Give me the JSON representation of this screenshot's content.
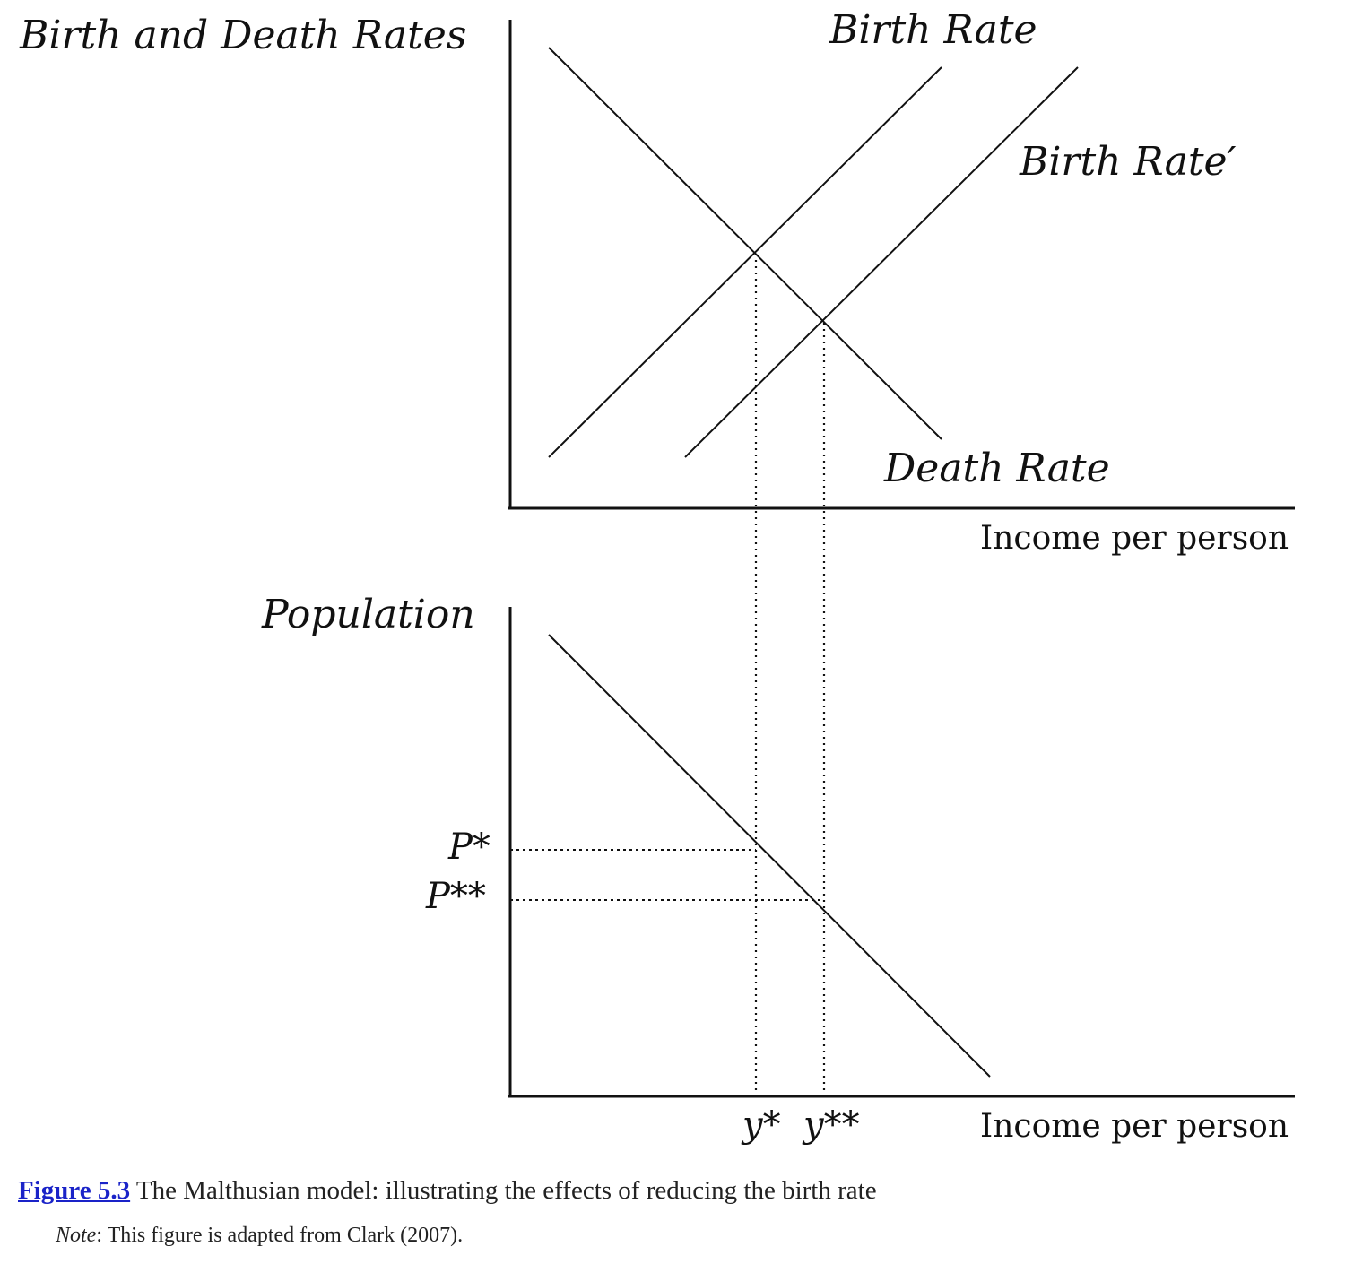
{
  "top_panel": {
    "y_axis_label": "Birth and Death Rates",
    "x_axis_label": "Income per person",
    "birth_rate_label": "Birth Rate",
    "birth_rate_prime_label": "Birth Rate′",
    "death_rate_label": "Death Rate"
  },
  "bottom_panel": {
    "y_axis_label": "Population",
    "x_axis_label": "Income per person",
    "p_star_label": "P*",
    "p_double_star_label": "P**",
    "y_star_label": "y*",
    "y_double_star_label": "y**"
  },
  "caption": {
    "figure_label": "Figure 5.3",
    "text": " The Malthusian model: illustrating the effects of reducing the birth rate"
  },
  "note": {
    "label": "Note",
    "text": ": This figure is adapted from Clark (2007)."
  },
  "colors": {
    "line": "#111111",
    "link": "#1a23c8"
  }
}
